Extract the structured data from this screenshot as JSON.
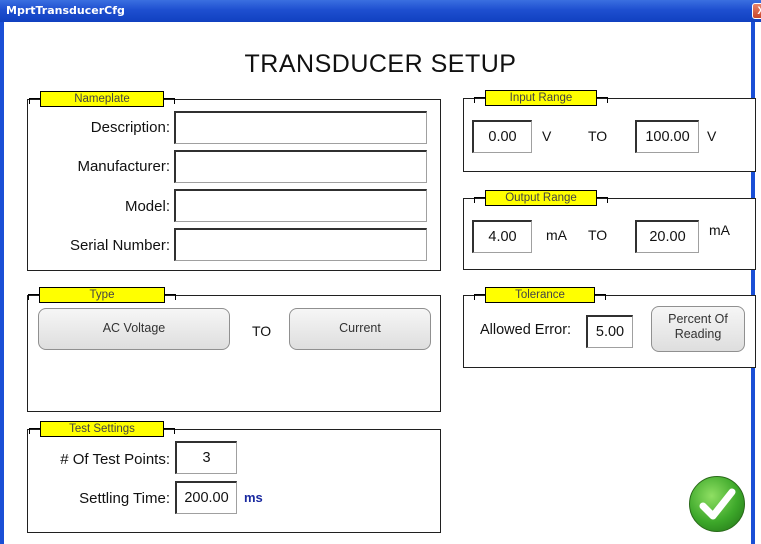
{
  "window": {
    "title": "MprtTransducerCfg",
    "close_glyph": "X"
  },
  "page_title": "TRANSDUCER SETUP",
  "nameplate": {
    "legend": "Nameplate",
    "description_label": "Description:",
    "manufacturer_label": "Manufacturer:",
    "model_label": "Model:",
    "serial_label": "Serial Number:",
    "description_value": "",
    "manufacturer_value": "",
    "model_value": "",
    "serial_value": ""
  },
  "input_range": {
    "legend": "Input Range",
    "from_value": "0.00",
    "from_unit": "V",
    "to_label": "TO",
    "to_value": "100.00",
    "to_unit": "V"
  },
  "output_range": {
    "legend": "Output Range",
    "from_value": "4.00",
    "from_unit": "mA",
    "to_label": "TO",
    "to_value": "20.00",
    "to_unit": "mA"
  },
  "type": {
    "legend": "Type",
    "from_button": "AC Voltage",
    "to_label": "TO",
    "to_button": "Current"
  },
  "tolerance": {
    "legend": "Tolerance",
    "allowed_error_label": "Allowed Error:",
    "allowed_error_value": "5.00",
    "mode_button_line1": "Percent Of",
    "mode_button_line2": "Reading"
  },
  "test_settings": {
    "legend": "Test Settings",
    "points_label": "# Of Test Points:",
    "points_value": "3",
    "settling_label": "Settling Time:",
    "settling_value": "200.00",
    "settling_unit": "ms"
  },
  "confirm": {
    "icon": "checkmark-icon",
    "color": "#3da82a"
  }
}
